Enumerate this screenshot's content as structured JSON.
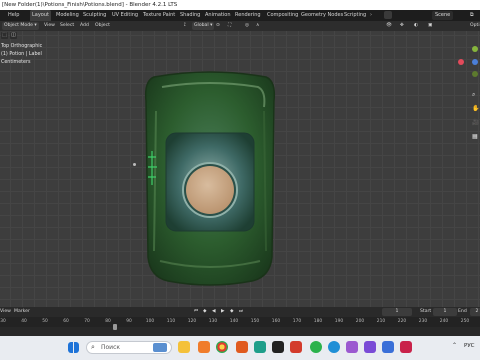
{
  "window": {
    "title": "[New Folder(1)\\Potions_Finish\\Potions.blend] - Blender 4.2.1 LTS",
    "minimize": "—",
    "maximize": "☐",
    "close": "✕"
  },
  "menubar": {
    "items": [
      "Help",
      "Layout",
      "Modeling",
      "Sculpting",
      "UV Editing",
      "Texture Paint",
      "Shading",
      "Animation",
      "Rendering",
      "Compositing",
      "Geometry Nodes",
      "Scripting"
    ],
    "active": "Layout",
    "scene_label": "Scene"
  },
  "toolbar": {
    "mode": "Object Mode",
    "items": [
      "View",
      "Select",
      "Add",
      "Object"
    ],
    "transform_orientation": "Global",
    "options_label": "Opti"
  },
  "viewport": {
    "view_name": "Top Orthographic",
    "object_label": "(1) Potion | Label",
    "units": "Centimeters"
  },
  "timeline": {
    "menu": [
      "View",
      "Marker"
    ],
    "current_frame": "1",
    "start_label": "Start",
    "start_value": "1",
    "end_label": "End",
    "end_value": "2",
    "ruler_ticks": [
      "30",
      "40",
      "50",
      "60",
      "70",
      "80",
      "90",
      "100",
      "110",
      "120",
      "130",
      "140",
      "150",
      "160",
      "170",
      "180",
      "190",
      "200",
      "210",
      "220",
      "230",
      "240",
      "250"
    ]
  },
  "taskbar": {
    "search_placeholder": "Поиск",
    "lang": "РУС"
  },
  "colors": {
    "accent": "#4772b3",
    "bottle_green": "#2e5a2c",
    "cork": "#c9a988"
  }
}
